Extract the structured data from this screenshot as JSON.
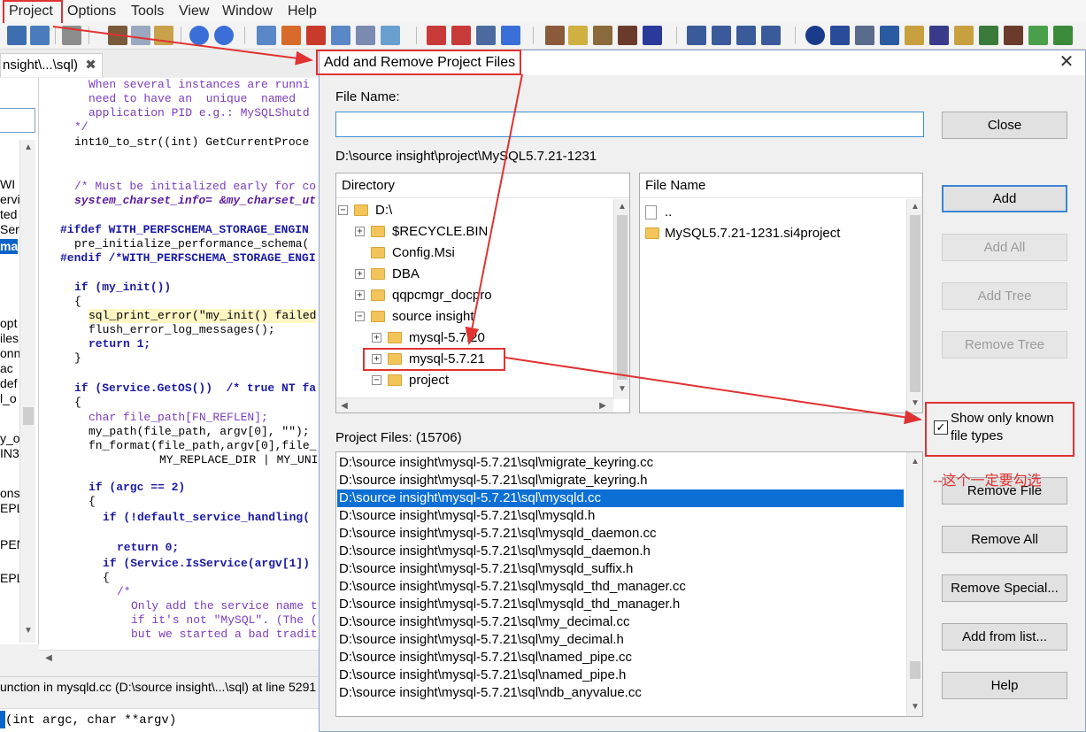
{
  "menu": [
    "Project",
    "Options",
    "Tools",
    "View",
    "Window",
    "Help"
  ],
  "editor": {
    "tab_label": "nsight\\...\\sql)",
    "left_items": [
      "WI",
      "ervi",
      "ted",
      "Serv",
      "ma",
      "opt",
      "iles",
      "onn",
      "ac",
      "def",
      "l_o",
      "y_o",
      "IN3",
      "ons",
      "EPL",
      "PEN",
      "EPL"
    ],
    "status": "unction in mysqld.cc (D:\\source insight\\...\\sql) at line 5291 (",
    "bottom_code": "(int argc, char **argv)",
    "code_lines": [
      "When several instances are runni",
      "need to have an  unique  named",
      "application PID e.g.: MySQLShutd",
      "*/",
      "int10_to_str((int) GetCurrentProce",
      "/* Must be initialized early for co",
      "system_charset_info= &my_charset_ut",
      "#ifdef WITH_PERFSCHEMA_STORAGE_ENGIN",
      "pre_initialize_performance_schema(",
      "#endif /*WITH_PERFSCHEMA_STORAGE_ENGI",
      "if (my_init())",
      "{",
      "sql_print_error(\"my_init() failed",
      "flush_error_log_messages();",
      "return 1;",
      "}",
      "if (Service.GetOS())  /* true NT fa",
      "{",
      "char file_path[FN_REFLEN];",
      "my_path(file_path, argv[0], \"\");",
      "fn_format(file_path,argv[0],file_",
      "MY_REPLACE_DIR | MY_UNI",
      "if (argc == 2)",
      "{",
      "if (!default_service_handling(",
      "return 0;",
      "if (Service.IsService(argv[1])",
      "{",
      "/*",
      "Only add the service name t",
      "if it's not \"MySQL\". (The (",
      "but we started a bad tradit"
    ]
  },
  "dialog": {
    "title": "Add and Remove Project Files",
    "file_name_label": "File Name:",
    "file_name_value": "",
    "current_path": "D:\\source insight\\project\\MySQL5.7.21-1231",
    "directory_header": "Directory",
    "file_name_header": "File Name",
    "tree": [
      {
        "label": "D:\\",
        "indent": 0,
        "expander": "-"
      },
      {
        "label": "$RECYCLE.BIN",
        "indent": 1,
        "expander": "+"
      },
      {
        "label": "Config.Msi",
        "indent": 1,
        "expander": ""
      },
      {
        "label": "DBA",
        "indent": 1,
        "expander": "+"
      },
      {
        "label": "qqpcmgr_docpro",
        "indent": 1,
        "expander": "+"
      },
      {
        "label": "source insight",
        "indent": 1,
        "expander": "-"
      },
      {
        "label": "mysql-5.7.20",
        "indent": 2,
        "expander": "+"
      },
      {
        "label": "mysql-5.7.21",
        "indent": 2,
        "expander": "+"
      },
      {
        "label": "project",
        "indent": 2,
        "expander": "-"
      }
    ],
    "files": [
      "..",
      "MySQL5.7.21-1231.si4project"
    ],
    "project_files_label": "Project Files: (15706)",
    "project_files": [
      "D:\\source insight\\mysql-5.7.21\\sql\\migrate_keyring.cc",
      "D:\\source insight\\mysql-5.7.21\\sql\\migrate_keyring.h",
      "D:\\source insight\\mysql-5.7.21\\sql\\mysqld.cc",
      "D:\\source insight\\mysql-5.7.21\\sql\\mysqld.h",
      "D:\\source insight\\mysql-5.7.21\\sql\\mysqld_daemon.cc",
      "D:\\source insight\\mysql-5.7.21\\sql\\mysqld_daemon.h",
      "D:\\source insight\\mysql-5.7.21\\sql\\mysqld_suffix.h",
      "D:\\source insight\\mysql-5.7.21\\sql\\mysqld_thd_manager.cc",
      "D:\\source insight\\mysql-5.7.21\\sql\\mysqld_thd_manager.h",
      "D:\\source insight\\mysql-5.7.21\\sql\\my_decimal.cc",
      "D:\\source insight\\mysql-5.7.21\\sql\\my_decimal.h",
      "D:\\source insight\\mysql-5.7.21\\sql\\named_pipe.cc",
      "D:\\source insight\\mysql-5.7.21\\sql\\named_pipe.h",
      "D:\\source insight\\mysql-5.7.21\\sql\\ndb_anyvalue.cc"
    ],
    "selected_project_file": 2,
    "buttons": {
      "close": "Close",
      "add": "Add",
      "add_all": "Add All",
      "add_tree": "Add Tree",
      "remove_tree": "Remove Tree",
      "remove_file": "Remove File",
      "remove_all": "Remove All",
      "remove_special": "Remove Special...",
      "add_from_list": "Add from list...",
      "help": "Help"
    },
    "show_known_types": {
      "label": "Show only known file types",
      "checked": true,
      "check_glyph": "✓"
    },
    "annotation": "--这个一定要勾选"
  },
  "colors": {
    "accent": "#0b6fd6",
    "annotation_red": "#e03232"
  }
}
